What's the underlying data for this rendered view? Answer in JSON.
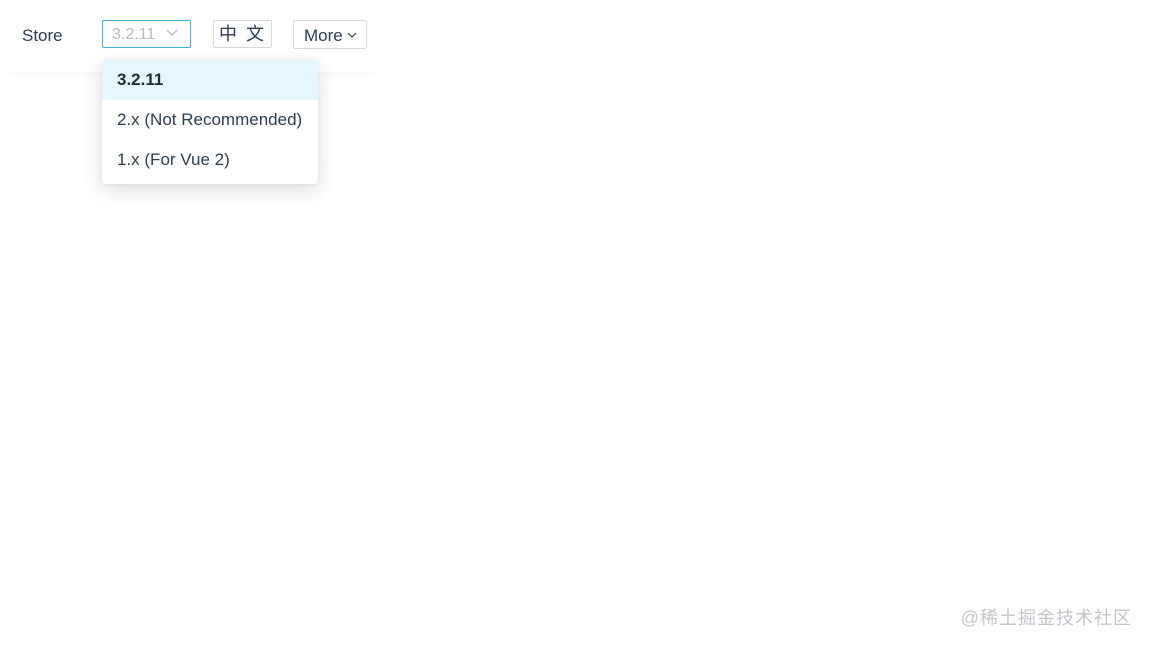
{
  "header": {
    "store_label": "Store",
    "version_select": {
      "value": "3.2.11",
      "border_color": "#42b0e0",
      "icon": "chevron-down-icon"
    },
    "lang_button_label": "中 文",
    "more_button": {
      "label": "More",
      "icon": "chevron-down-icon"
    }
  },
  "version_dropdown": {
    "options": [
      {
        "label": "3.2.11",
        "selected": true
      },
      {
        "label": "2.x (Not Recommended)",
        "selected": false
      },
      {
        "label": "1.x (For Vue 2)",
        "selected": false
      }
    ],
    "highlight_color": "#e6f6fd"
  },
  "watermark": "@稀土掘金技术社区"
}
